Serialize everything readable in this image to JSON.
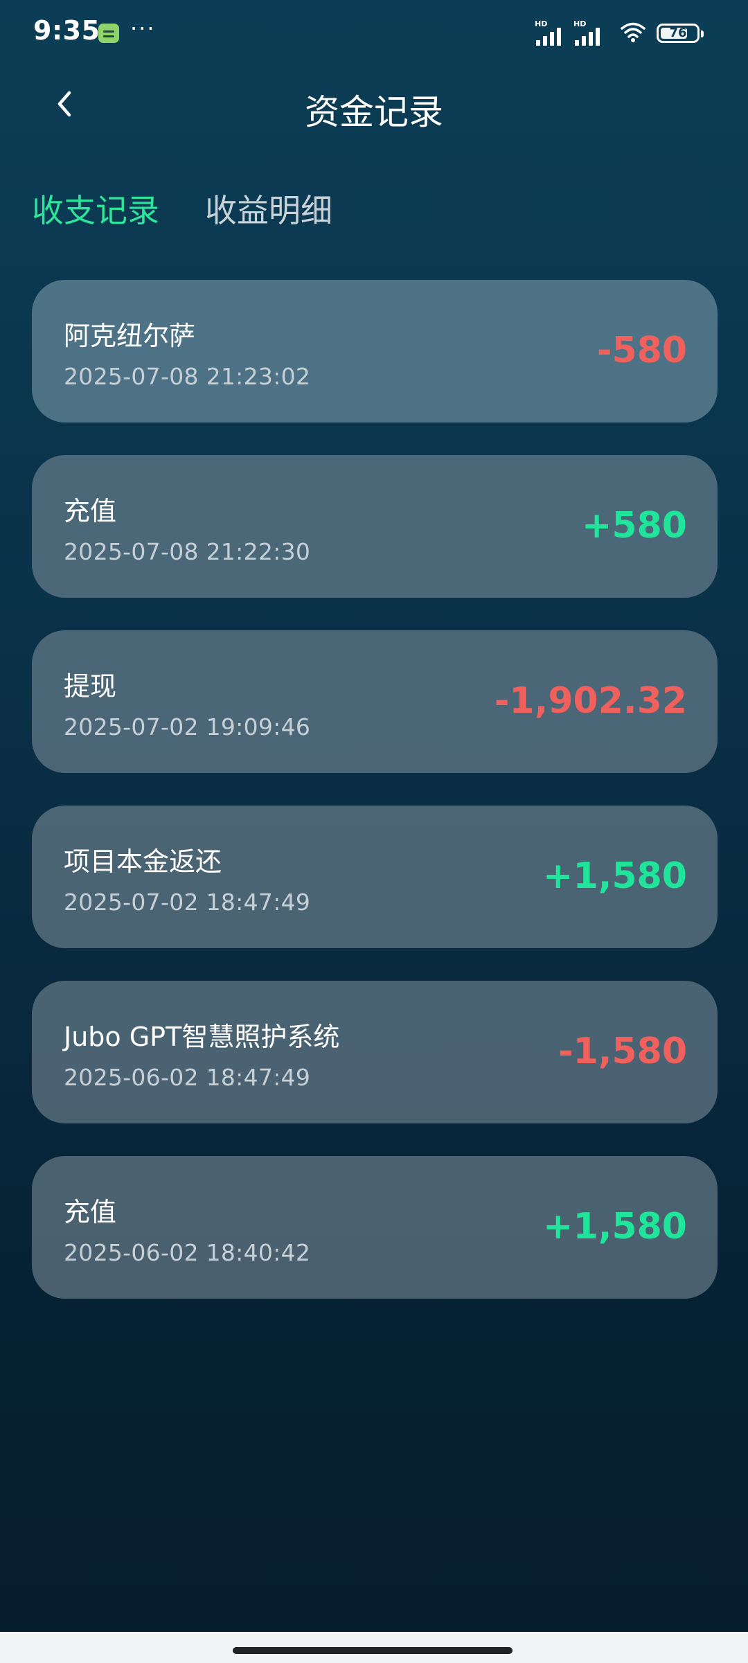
{
  "status_bar": {
    "time": "9:35",
    "more": "···",
    "signal_1_label": "HD",
    "signal_2_label": "HD",
    "battery_level": "76",
    "battery_fraction": 0.76
  },
  "header": {
    "title": "资金记录"
  },
  "tabs": [
    {
      "label": "收支记录",
      "active": true
    },
    {
      "label": "收益明细",
      "active": false
    }
  ],
  "records": [
    {
      "name": "阿克纽尔萨",
      "time": "2025-07-08 21:23:02",
      "amount": "-580",
      "type": "negative"
    },
    {
      "name": "充值",
      "time": "2025-07-08 21:22:30",
      "amount": "+580",
      "type": "positive"
    },
    {
      "name": "提现",
      "time": "2025-07-02 19:09:46",
      "amount": "-1,902.32",
      "type": "negative"
    },
    {
      "name": "项目本金返还",
      "time": "2025-07-02 18:47:49",
      "amount": "+1,580",
      "type": "positive"
    },
    {
      "name": "Jubo GPT智慧照护系统",
      "time": "2025-06-02 18:47:49",
      "amount": "-1,580",
      "type": "negative"
    },
    {
      "name": "充值",
      "time": "2025-06-02 18:40:42",
      "amount": "+1,580",
      "type": "positive"
    }
  ],
  "colors": {
    "accent_green": "#2ee59a",
    "positive": "#1fe49a",
    "negative": "#f0605c"
  },
  "icons": {
    "back": "chevron-left-icon",
    "message": "message-icon",
    "wifi": "wifi-icon",
    "battery": "battery-icon",
    "signal": "signal-icon"
  }
}
